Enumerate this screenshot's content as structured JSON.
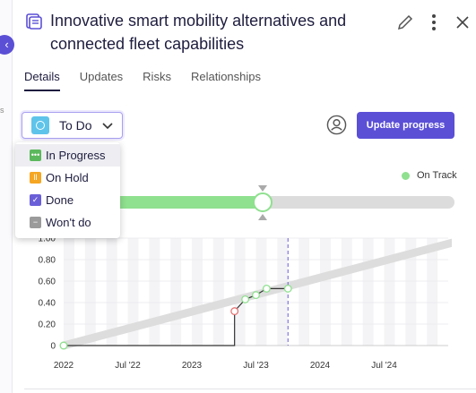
{
  "header": {
    "title": "Innovative smart mobility alternatives and connected fleet capabilities",
    "title_icon": "document-icon",
    "actions": [
      "edit-icon",
      "more-icon",
      "close-icon"
    ]
  },
  "tabs": [
    {
      "label": "Details",
      "active": true
    },
    {
      "label": "Updates",
      "active": false
    },
    {
      "label": "Risks",
      "active": false
    },
    {
      "label": "Relationships",
      "active": false
    }
  ],
  "status": {
    "current": "To Do",
    "current_color": "#5fc4ea",
    "options": [
      {
        "label": "In Progress",
        "color": "#5cb85c",
        "icon": "dots-icon"
      },
      {
        "label": "On Hold",
        "color": "#f5a623",
        "icon": "pause-icon"
      },
      {
        "label": "Done",
        "color": "#6b5fd8",
        "icon": "check-icon"
      },
      {
        "label": "Won't do",
        "color": "#9b9b9b",
        "icon": "minus-icon"
      }
    ]
  },
  "update_button": "Update progress",
  "owner_icon": "user-circle-icon",
  "collapse_icon": "chevron-left-icon",
  "legend": {
    "label": "On Track",
    "color": "#8fe08f"
  },
  "progress": {
    "fraction": 0.52,
    "color": "#8fe08f",
    "track_color": "#dcdcdc"
  },
  "chart_data": {
    "type": "line",
    "title": "",
    "xlabel": "",
    "ylabel": "",
    "x_ticks": [
      "2022",
      "Jul '22",
      "2023",
      "Jul '23",
      "2024",
      "Jul '24"
    ],
    "y_ticks": [
      "0",
      "0.20",
      "0.40",
      "0.60",
      "0.80",
      "1.00"
    ],
    "ylim": [
      0,
      1.0
    ],
    "series": [
      {
        "values_x": [
          "2022-01",
          "2025-03"
        ],
        "values_y": [
          0.0,
          1.0
        ],
        "color": "#dddddd"
      },
      {
        "values_x": [
          "2022-01",
          "2023-05",
          "2023-05",
          "2023-06",
          "2023-07",
          "2023-08",
          "2023-10"
        ],
        "values_y": [
          0,
          0,
          0.32,
          0.43,
          0.47,
          0.53,
          0.53
        ],
        "color": "#333333"
      }
    ],
    "points": [
      {
        "x": "2022-01",
        "y": 0.0,
        "color": "#8fe08f"
      },
      {
        "x": "2023-05",
        "y": 0.32,
        "color": "#e57373"
      },
      {
        "x": "2023-06",
        "y": 0.43,
        "color": "#8fe08f"
      },
      {
        "x": "2023-07",
        "y": 0.47,
        "color": "#8fe08f"
      },
      {
        "x": "2023-08",
        "y": 0.53,
        "color": "#8fe08f"
      },
      {
        "x": "2023-10",
        "y": 0.53,
        "color": "#8fe08f"
      }
    ],
    "today_marker": "2023-10",
    "grid": true
  }
}
